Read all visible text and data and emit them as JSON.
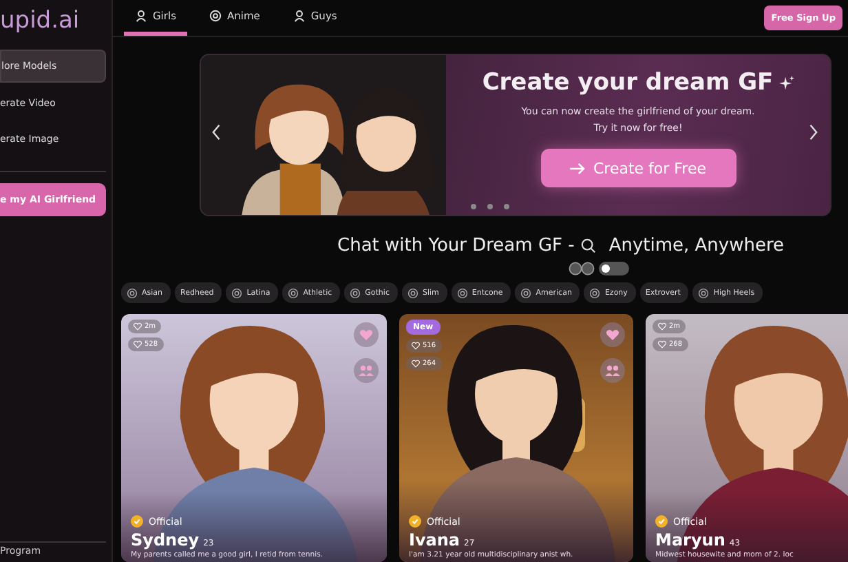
{
  "logo": "upid.ai",
  "sidebar": {
    "items": [
      {
        "label": "lore Models",
        "selected": true
      },
      {
        "label": "erate Video",
        "selected": false
      },
      {
        "label": "erate Image",
        "selected": false
      }
    ],
    "cta": "e my AI Girlfriend",
    "footer": "Program"
  },
  "tabs": [
    {
      "label": "Girls",
      "kind": "person",
      "selected": true
    },
    {
      "label": "Anime",
      "kind": "anime",
      "selected": false
    },
    {
      "label": "Guys",
      "kind": "person",
      "selected": false
    }
  ],
  "signup": "Free Sign Up",
  "banner": {
    "title": "Create your dream GF",
    "lines": [
      "You can now create the girlfriend of your dream.",
      "Try it now for free!"
    ],
    "button": "Create for Free"
  },
  "heading": {
    "before": "Chat with Your Dream GF -",
    "after": "Anytime, Anywhere"
  },
  "toggle": {
    "on": false
  },
  "tags": [
    {
      "label": "Asian",
      "kind": "icon"
    },
    {
      "label": "Redheed",
      "kind": "plain"
    },
    {
      "label": "Latina",
      "kind": "icon"
    },
    {
      "label": "Athletic",
      "kind": "icon"
    },
    {
      "label": "Gothic",
      "kind": "icon"
    },
    {
      "label": "Slim",
      "kind": "icon"
    },
    {
      "label": "Entcone",
      "kind": "icon"
    },
    {
      "label": "American",
      "kind": "icon"
    },
    {
      "label": "Ezony",
      "kind": "icon"
    },
    {
      "label": "Extrovert",
      "kind": "plain"
    },
    {
      "label": "High Heels",
      "kind": "icon"
    }
  ],
  "cards": [
    {
      "name": "Sydney",
      "age": "23",
      "badge": "Official",
      "new": false,
      "stats": [
        "2m",
        "528"
      ],
      "description": "My parents called me a good girl, I retid from tennis."
    },
    {
      "name": "Ivana",
      "age": "27",
      "badge": "Official",
      "new": true,
      "new_label": "New",
      "stats": [
        "516",
        "264"
      ],
      "description": "I'am 3.21 year old multidisciplinary anist wh."
    },
    {
      "name": "Maryun",
      "age": "43",
      "badge": "Official",
      "new": false,
      "stats": [
        "2m",
        "268"
      ],
      "description": "Midwest housewite and mom of 2. loc"
    }
  ]
}
